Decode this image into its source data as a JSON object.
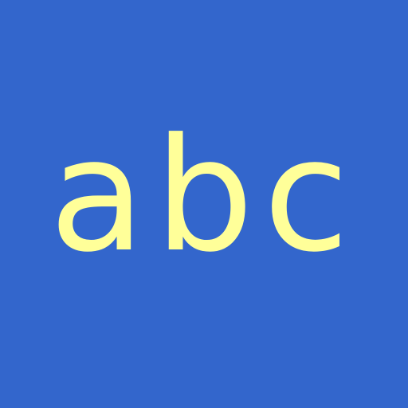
{
  "background_color": "#3366cc",
  "text_color": "#ffff99",
  "text": "abc"
}
